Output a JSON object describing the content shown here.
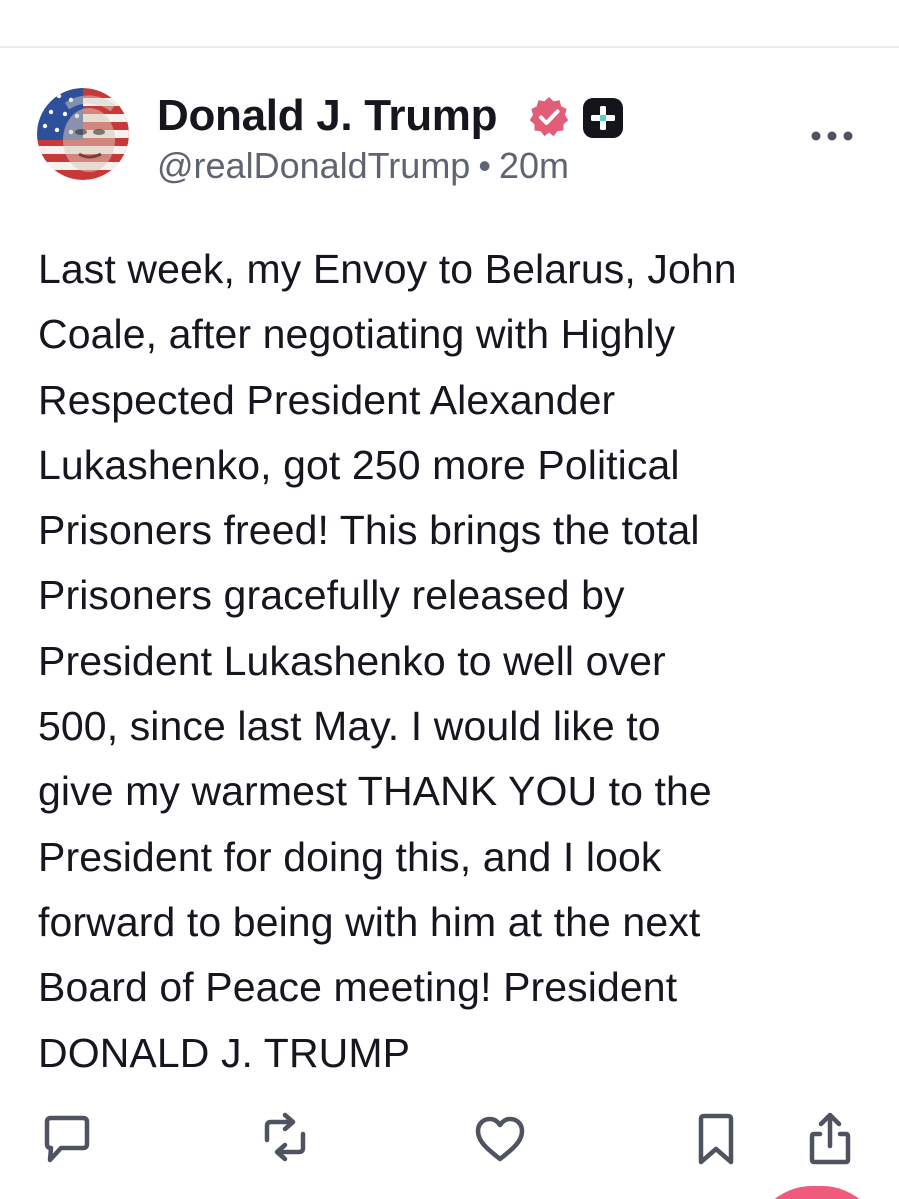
{
  "post": {
    "author": {
      "display_name": "Donald J. Trump",
      "handle": "@realDonaldTrump",
      "verified_icon": "verified-badge-icon",
      "premium_icon": "plus-badge-icon"
    },
    "separator": "•",
    "timestamp": "20m",
    "text": "Last week, my Envoy to Belarus, John\nCoale, after negotiating with Highly\nRespected President Alexander\nLukashenko, got 250 more Political\nPrisoners freed! This brings the total\nPrisoners gracefully released by\nPresident Lukashenko to well over\n500, since last May. I would like to\ngive my warmest THANK YOU to the\nPresident for doing this, and I look\nforward to being with him at the next\nBoard of Peace meeting! President\nDONALD J. TRUMP",
    "actions": [
      {
        "name": "reply",
        "icon": "reply-icon"
      },
      {
        "name": "repost",
        "icon": "repost-icon"
      },
      {
        "name": "like",
        "icon": "heart-icon"
      },
      {
        "name": "bookmark",
        "icon": "bookmark-icon"
      },
      {
        "name": "share",
        "icon": "share-icon"
      }
    ]
  },
  "colors": {
    "text_primary": "#16161f",
    "text_secondary": "#5f6472",
    "verified_badge": "#e25d78",
    "accent_fab": "#ef5a7d",
    "divider": "#ececf0"
  }
}
